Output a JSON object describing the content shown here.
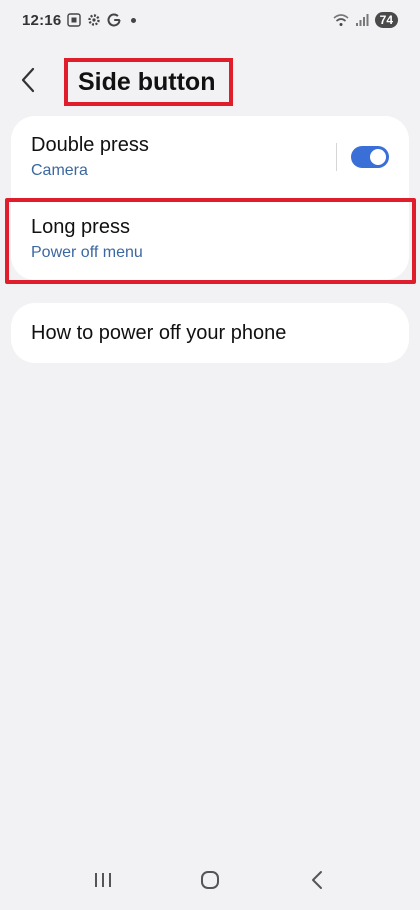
{
  "status_bar": {
    "time": "12:16",
    "battery": "74",
    "icons": [
      "screenshot-icon",
      "settings-icon",
      "google-icon",
      "notification-dot",
      "wifi-icon",
      "signal-icon"
    ]
  },
  "header": {
    "title": "Side button",
    "back_icon": "chevron-left-icon"
  },
  "settings": {
    "double_press": {
      "title": "Double press",
      "subtitle": "Camera",
      "toggle_on": true
    },
    "long_press": {
      "title": "Long press",
      "subtitle": "Power off menu"
    },
    "help_link": {
      "title": "How to power off your phone"
    }
  },
  "colors": {
    "accent": "#3a6fd8",
    "subtitle": "#3c68a0",
    "highlight": "#e01e2b",
    "background": "#f2f2f5"
  },
  "nav_bar": {
    "icons": [
      "recent-apps-icon",
      "home-icon",
      "back-icon"
    ]
  }
}
